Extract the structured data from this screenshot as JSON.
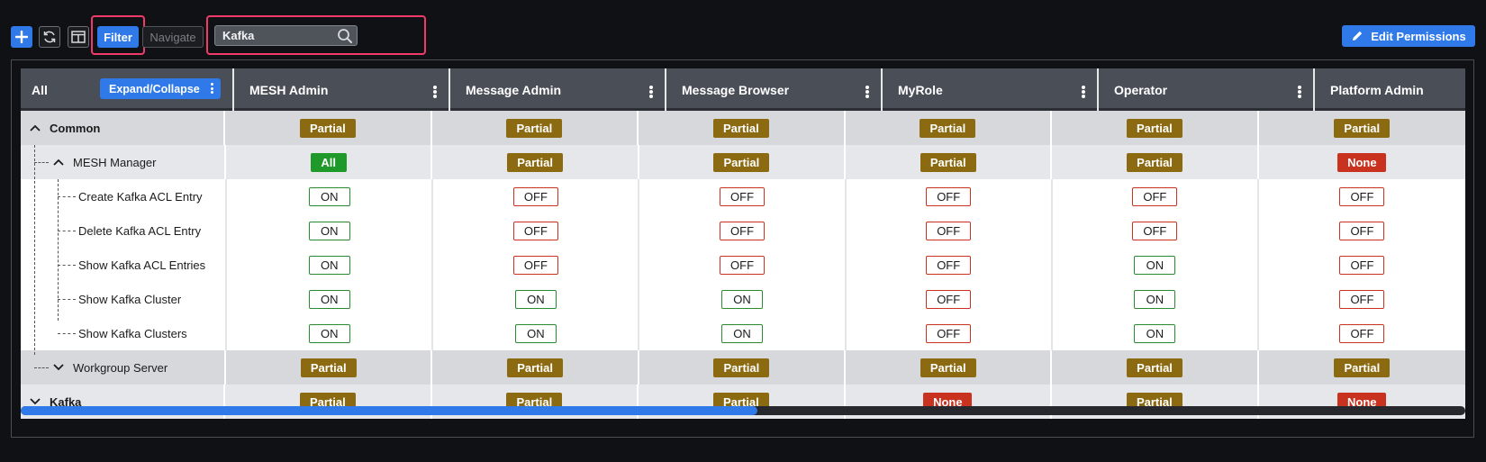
{
  "toolbar": {
    "filter_label": "Filter",
    "navigate_label": "Navigate",
    "search_value": "Kafka",
    "edit_permissions_label": "Edit Permissions",
    "icons": {
      "add": "plus-icon",
      "refresh": "refresh-icon",
      "layout": "columns-layout-icon",
      "search": "search-icon",
      "edit": "pencil-icon"
    },
    "accent_color": "#2f79e8",
    "highlight_color": "#ef3a6a"
  },
  "grid": {
    "first_column": {
      "label": "All",
      "expand_button_label": "Expand/Collapse"
    },
    "roles": [
      "MESH Admin",
      "Message Admin",
      "Message Browser",
      "MyRole",
      "Operator",
      "Platform Admin"
    ],
    "rows": [
      {
        "name": "Common",
        "level": 0,
        "kind": "group-top",
        "expanded": true,
        "values": [
          "Partial",
          "Partial",
          "Partial",
          "Partial",
          "Partial",
          "Partial"
        ]
      },
      {
        "name": "MESH Manager",
        "level": 1,
        "kind": "group-sub",
        "expanded": true,
        "values": [
          "All",
          "Partial",
          "Partial",
          "Partial",
          "Partial",
          "None"
        ]
      },
      {
        "name": "Create Kafka ACL Entry",
        "level": 2,
        "kind": "leaf",
        "values": [
          "ON",
          "OFF",
          "OFF",
          "OFF",
          "OFF",
          "OFF"
        ]
      },
      {
        "name": "Delete Kafka ACL Entry",
        "level": 2,
        "kind": "leaf",
        "values": [
          "ON",
          "OFF",
          "OFF",
          "OFF",
          "OFF",
          "OFF"
        ]
      },
      {
        "name": "Show Kafka ACL Entries",
        "level": 2,
        "kind": "leaf",
        "values": [
          "ON",
          "OFF",
          "OFF",
          "OFF",
          "ON",
          "OFF"
        ]
      },
      {
        "name": "Show Kafka Cluster",
        "level": 2,
        "kind": "leaf",
        "values": [
          "ON",
          "ON",
          "ON",
          "OFF",
          "ON",
          "OFF"
        ]
      },
      {
        "name": "Show Kafka Clusters",
        "level": 2,
        "kind": "leaf",
        "values": [
          "ON",
          "ON",
          "ON",
          "OFF",
          "ON",
          "OFF"
        ]
      },
      {
        "name": "Workgroup Server",
        "level": 1,
        "kind": "group-top",
        "expanded": false,
        "values": [
          "Partial",
          "Partial",
          "Partial",
          "Partial",
          "Partial",
          "Partial"
        ]
      },
      {
        "name": "Kafka",
        "level": 0,
        "kind": "group-sub",
        "expanded": false,
        "values": [
          "Partial",
          "Partial",
          "Partial",
          "None",
          "Partial",
          "None"
        ]
      }
    ],
    "status_colors": {
      "Partial": "#8b6a12",
      "All": "#1f9a2a",
      "None": "#c8321f",
      "ON": "#2a8a2f",
      "OFF": "#c8321f"
    },
    "horizontal_scroll_fraction": 0.51
  }
}
